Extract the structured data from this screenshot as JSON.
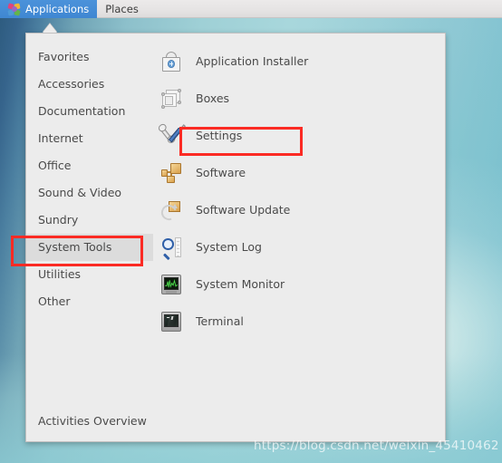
{
  "topbar": {
    "items": [
      {
        "label": "Applications",
        "icon": "fedora-icon",
        "active": true
      },
      {
        "label": "Places",
        "icon": null,
        "active": false
      }
    ]
  },
  "menu": {
    "categories": [
      {
        "label": "Favorites",
        "selected": false
      },
      {
        "label": "Accessories",
        "selected": false
      },
      {
        "label": "Documentation",
        "selected": false
      },
      {
        "label": "Internet",
        "selected": false
      },
      {
        "label": "Office",
        "selected": false
      },
      {
        "label": "Sound & Video",
        "selected": false
      },
      {
        "label": "Sundry",
        "selected": false
      },
      {
        "label": "System Tools",
        "selected": true
      },
      {
        "label": "Utilities",
        "selected": false
      },
      {
        "label": "Other",
        "selected": false
      }
    ],
    "applications": [
      {
        "label": "Application Installer",
        "icon": "shopping-bag-icon"
      },
      {
        "label": "Boxes",
        "icon": "cube-wireframe-icon"
      },
      {
        "label": "Settings",
        "icon": "wrench-screwdriver-icon"
      },
      {
        "label": "Software",
        "icon": "orange-packages-icon"
      },
      {
        "label": "Software Update",
        "icon": "package-refresh-icon"
      },
      {
        "label": "System Log",
        "icon": "magnifier-page-icon"
      },
      {
        "label": "System Monitor",
        "icon": "monitor-graph-icon"
      },
      {
        "label": "Terminal",
        "icon": "terminal-icon"
      }
    ],
    "footer": {
      "label": "Activities Overview"
    }
  },
  "annotations": {
    "highlight_color": "#fb2b24",
    "boxes": [
      {
        "name": "system-tools-highlight"
      },
      {
        "name": "settings-highlight"
      }
    ]
  },
  "watermark": {
    "text": "https://blog.csdn.net/weixin_45410462"
  }
}
